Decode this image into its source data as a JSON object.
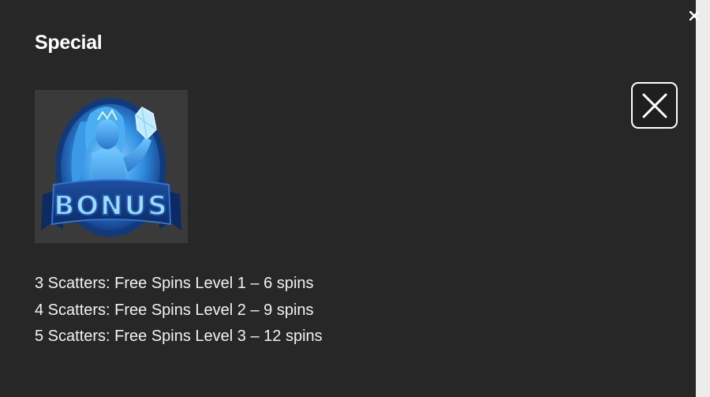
{
  "dialog": {
    "title": "Special",
    "symbol": {
      "icon": "bonus-scatter-symbol",
      "text": "BONUS"
    },
    "close_icon": "close-icon",
    "rules": [
      "3 Scatters: Free Spins Level 1 – 6 spins",
      "4 Scatters: Free Spins Level 2 – 9 spins",
      "5 Scatters: Free Spins Level 3 – 12 spins"
    ]
  },
  "colors": {
    "panel_background": "#272727",
    "text": "#ffffff",
    "symbol_blue": "#3fa9f5",
    "tile_background": "#3a3a3a"
  }
}
